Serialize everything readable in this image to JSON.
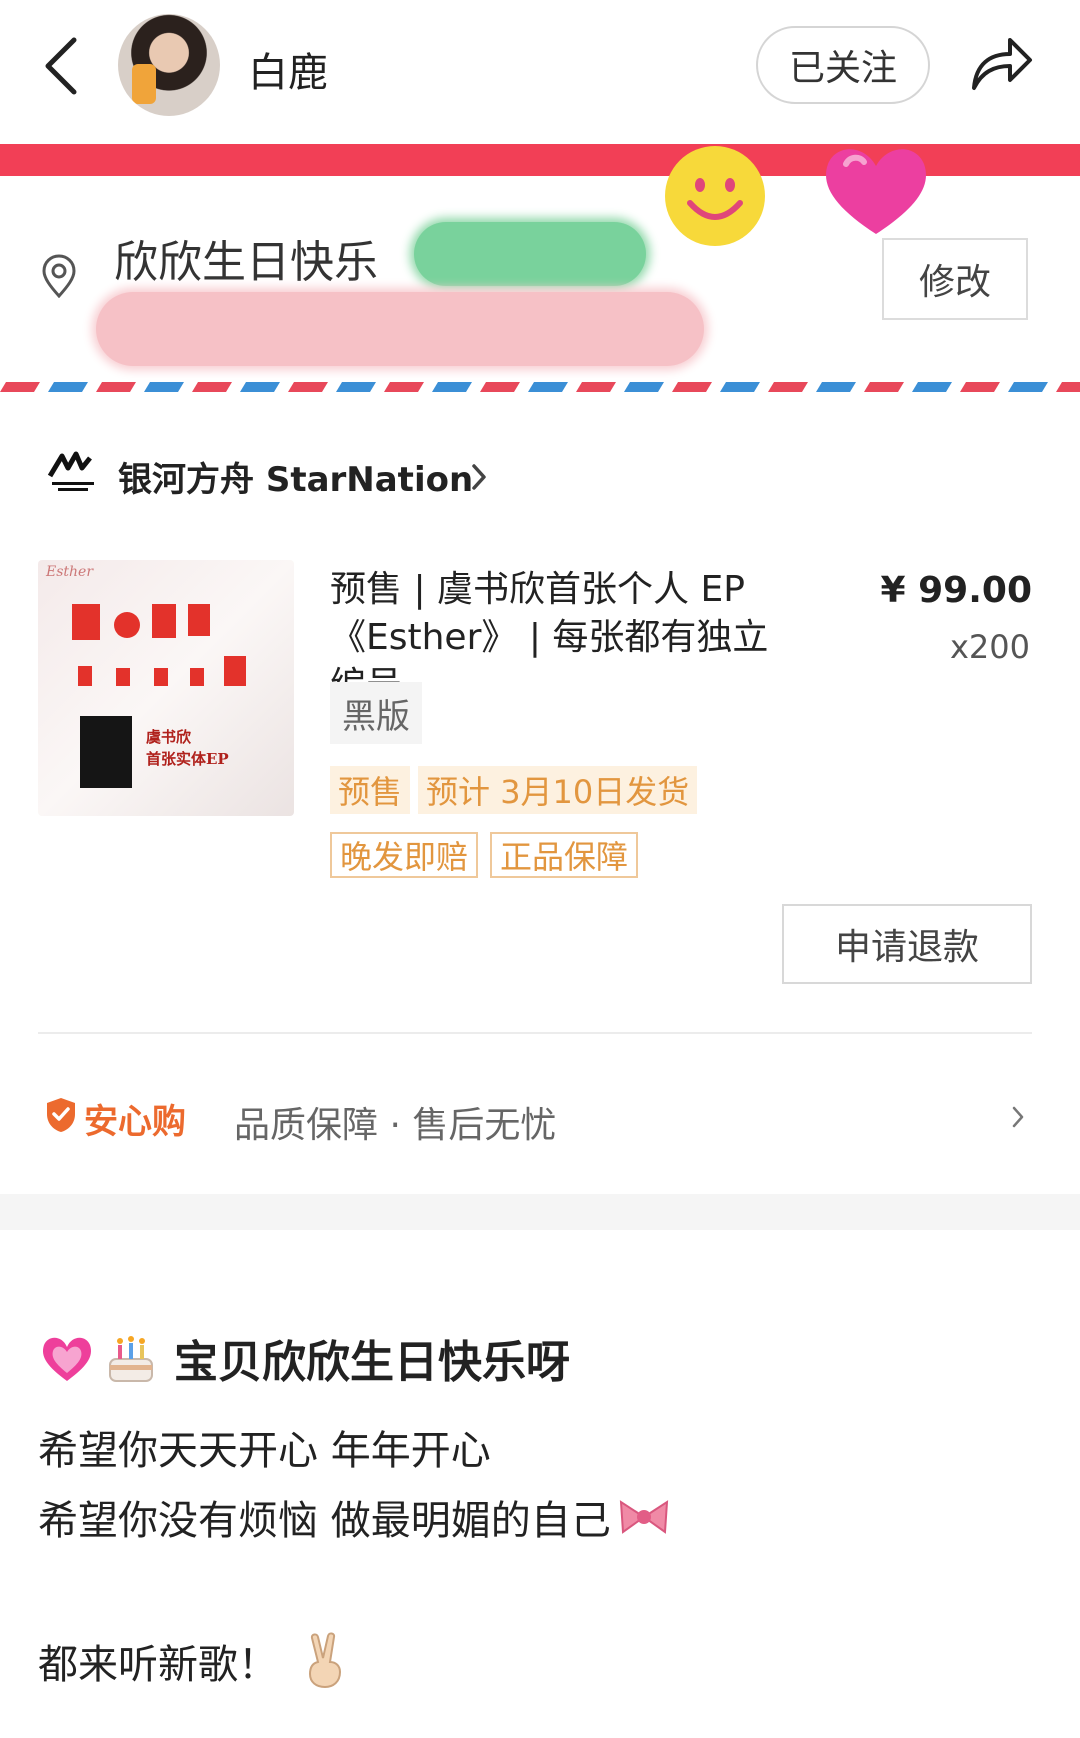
{
  "header": {
    "user_name": "白鹿",
    "follow_label": "已关注"
  },
  "address": {
    "name": "欣欣生日快乐",
    "edit_label": "修改"
  },
  "shop": {
    "name": "银河方舟 StarNation"
  },
  "product": {
    "title": "预售 | 虞书欣首张个人 EP《Esther》 | 每张都有独立编号",
    "price": "¥ 99.00",
    "quantity": "x200",
    "variant": "黑版",
    "presale_tag": "预售",
    "ship_tag": "预计 3月10日发货",
    "service_tags": [
      "晚发即赔",
      "正品保障"
    ],
    "refund_label": "申请退款",
    "cover_text": "虞书欣\n首张实体EP"
  },
  "assurance": {
    "brand": "安心购",
    "desc": "品质保障 · 售后无忧"
  },
  "note": {
    "title": "宝贝欣欣生日快乐呀",
    "line1": "希望你天天开心 年年开心",
    "line2": "希望你没有烦恼 做最明媚的自己",
    "line3": "都来听新歌！"
  },
  "icons": {
    "back": "chevron-left-icon",
    "share": "share-arrow-icon",
    "location": "location-pin-icon",
    "shop_chevron": "chevron-right-icon",
    "shield": "shield-icon",
    "emojis": [
      "heart-emoji",
      "cake-emoji",
      "bow-emoji",
      "victory-hand-emoji"
    ]
  },
  "colors": {
    "accent_red": "#f23f56",
    "tag_orange": "#e2963f",
    "assure_orange": "#ec6a2e"
  }
}
